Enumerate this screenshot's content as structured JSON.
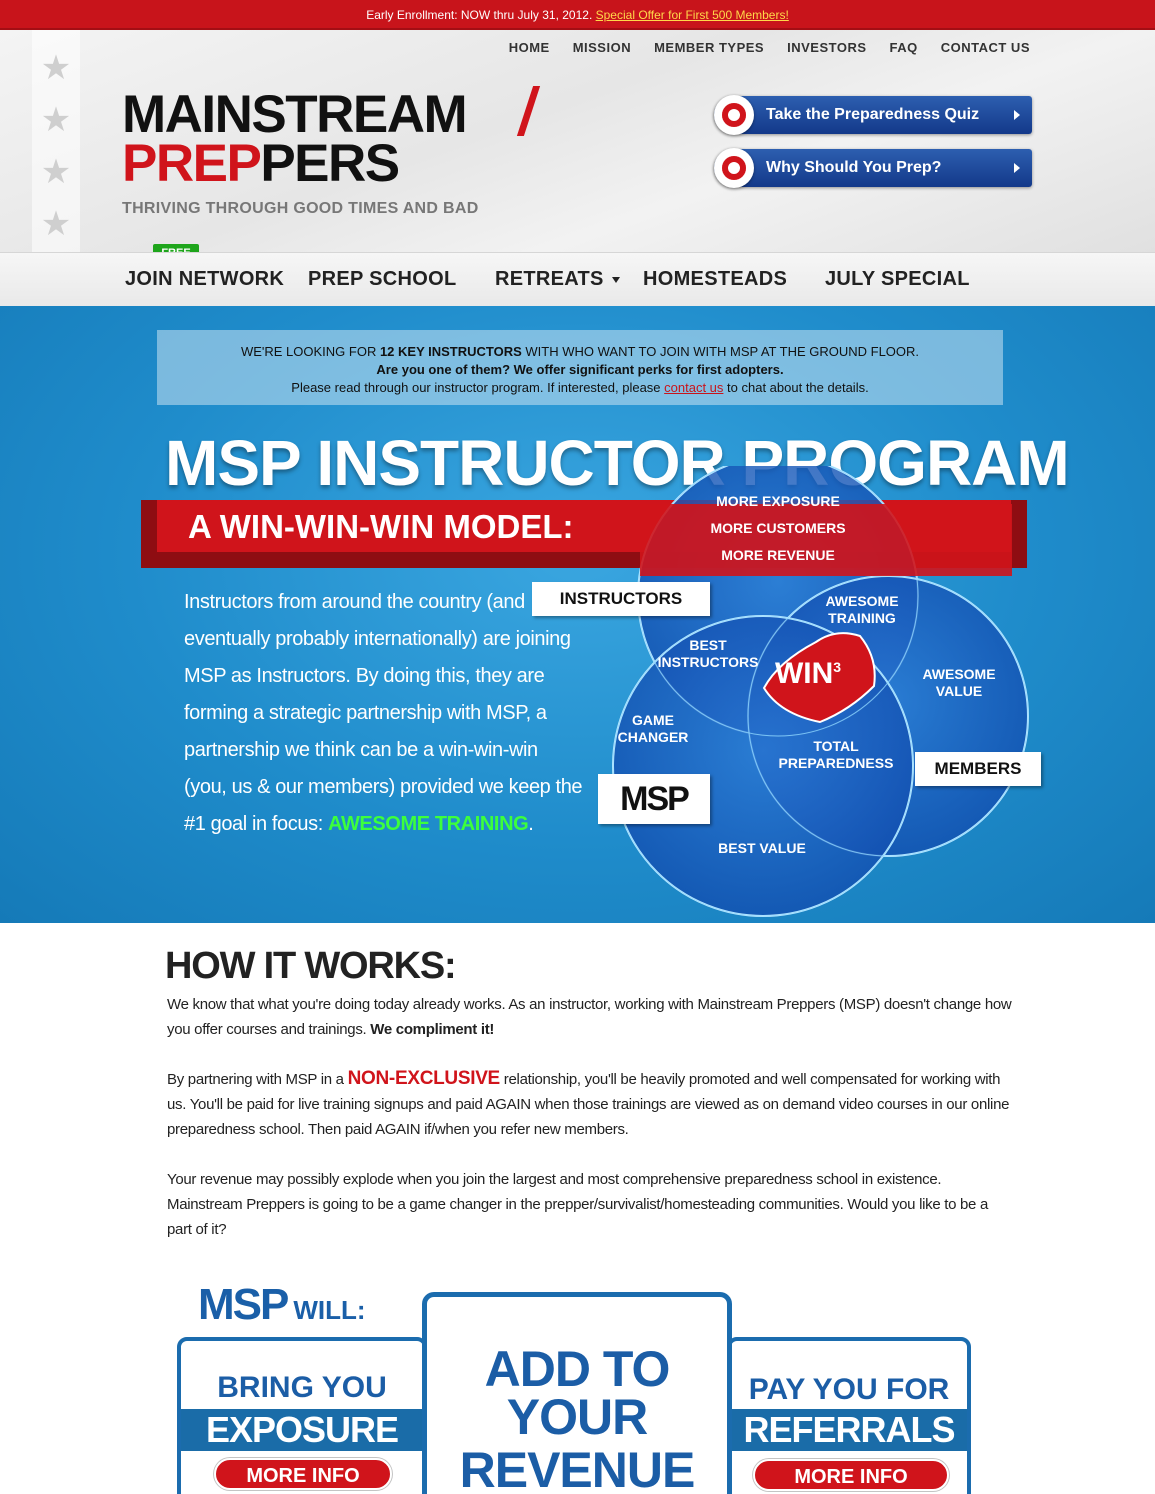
{
  "topbar": {
    "text": "Early Enrollment: NOW thru July 31, 2012.",
    "link": "Special Offer for First 500 Members!"
  },
  "topnav": [
    "HOME",
    "MISSION",
    "MEMBER TYPES",
    "INVESTORS",
    "FAQ",
    "CONTACT US"
  ],
  "logo": {
    "line1": "MAINSTREAM",
    "line2_red": "PREP",
    "line2_black": "PERS",
    "tagline": "THRIVING THROUGH GOOD TIMES AND BAD"
  },
  "cta": {
    "quiz": "Take the Preparedness Quiz",
    "why": "Why Should You Prep?"
  },
  "mainnav": {
    "badge": "FREE",
    "items": [
      "JOIN NETWORK",
      "PREP SCHOOL",
      "RETREATS",
      "HOMESTEADS",
      "JULY SPECIAL"
    ]
  },
  "notice": {
    "l1a": "WE'RE LOOKING FOR ",
    "l1b": "12 KEY INSTRUCTORS",
    "l1c": " WITH WHO WANT TO JOIN WITH MSP AT THE GROUND FLOOR.",
    "l2": "Are you one of them? We offer significant perks for first adopters.",
    "l3a": "Please read through our instructor program.  If interested, please ",
    "l3link": "contact us",
    "l3b": " to chat about the details."
  },
  "hero": {
    "title": "MSP INSTRUCTOR PROGRAM",
    "band": "A WIN-WIN-WIN MODEL:",
    "lead": "Instructors from around the country (and eventually probably internationally) are joining MSP as Instructors.  By doing this, they are forming a strategic partnership with MSP, a partnership we think can be a win-win-win (you, us & our members) provided we keep the #1 goal in focus: ",
    "lead_green": "AWESOME TRAINING",
    "lead_end": "."
  },
  "venn": {
    "top1": "MORE EXPOSURE",
    "top2": "MORE CUSTOMERS",
    "top3": "MORE REVENUE",
    "awesome_training": "AWESOME TRAINING",
    "awesome_value": "AWESOME VALUE",
    "best_instructors": "BEST INSTRUCTORS",
    "win": "WIN",
    "win_sup": "3",
    "game_changer": "GAME CHANGER",
    "total_prep": "TOTAL PREPAREDNESS",
    "best_value": "BEST VALUE",
    "label_instructors": "INSTRUCTORS",
    "label_members": "MEMBERS",
    "label_msp": "MSP"
  },
  "hiw": {
    "title": "HOW IT WORKS:",
    "p1": "We know that what you're doing today already works.  As an instructor, working with Mainstream Preppers (MSP) doesn't change how you offer courses and trainings.  ",
    "p1b": "We compliment it!",
    "p2a": "By partnering with MSP in a ",
    "p2nonex": "NON-EXCLUSIVE",
    "p2b": " relationship, you'll be heavily promoted and well compensated for working with us.  You'll be paid for live training signups and paid AGAIN when those trainings are viewed as on demand video courses in our online preparedness school.  Then paid AGAIN if/when you refer new members.",
    "p3": "Your revenue may possibly explode when you join the largest and most comprehensive preparedness school in existence.  Mainstream Preppers is going to be a game changer in the prepper/survivalist/homesteading communities.  Would you like to be a part of it?"
  },
  "will": {
    "msp": "MSP",
    "will": "WILL:",
    "left_small": "BRING YOU",
    "left_big": "EXPOSURE",
    "center1": "ADD TO",
    "center2": "YOUR",
    "center3": "REVENUE",
    "right_small": "PAY YOU FOR",
    "right_big": "REFERRALS",
    "more": "MORE INFO"
  },
  "colors": {
    "brand_red": "#d0141b",
    "brand_blue": "#1b6cae",
    "hero_blue": "#1f8ccb",
    "accent_green": "#3cff3c"
  }
}
